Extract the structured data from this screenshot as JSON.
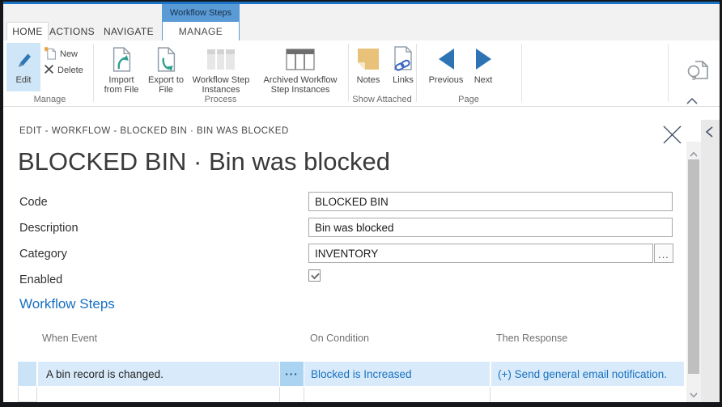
{
  "colors": {
    "accent_blue": "#1a73c7",
    "link_blue": "#1770c0",
    "contextual_tab_blue": "#5a9bd5",
    "selected_row_blue": "#d9ebfa",
    "edit_button_blue": "#cfe6f8",
    "notes_yellow": "#e9c27a"
  },
  "ribbon": {
    "contextual_label": "Workflow Steps",
    "tabs": [
      {
        "label": "HOME",
        "active": true
      },
      {
        "label": "ACTIONS"
      },
      {
        "label": "NAVIGATE"
      },
      {
        "label": "MANAGE",
        "contextual": true
      }
    ],
    "buttons": {
      "edit": "Edit",
      "new": "New",
      "delete": "Delete",
      "import": "Import from File",
      "export": "Export to File",
      "workflow_step_instances": "Workflow Step Instances",
      "archived_workflow_step_instances": "Archived Workflow Step Instances",
      "notes": "Notes",
      "links": "Links",
      "previous": "Previous",
      "next": "Next"
    },
    "groups": [
      {
        "label": "Manage"
      },
      {
        "label": "Process"
      },
      {
        "label": "Show Attached"
      },
      {
        "label": "Page"
      }
    ]
  },
  "page": {
    "caption": "EDIT - WORKFLOW - BLOCKED BIN · BIN WAS BLOCKED",
    "title": "BLOCKED BIN · Bin was blocked",
    "fields": {
      "code": {
        "label": "Code",
        "value": "BLOCKED BIN"
      },
      "description": {
        "label": "Description",
        "value": "Bin was blocked"
      },
      "category": {
        "label": "Category",
        "value": "INVENTORY",
        "lookup_glyph": "..."
      },
      "enabled": {
        "label": "Enabled",
        "checked": true
      }
    },
    "section": {
      "heading": "Workflow Steps",
      "columns": {
        "when": "When Event",
        "condition": "On Condition",
        "response": "Then Response"
      },
      "rows": [
        {
          "when_event": "A bin record is changed.",
          "assist_glyph": "···",
          "on_condition": "Blocked is Increased",
          "then_response": "(+) Send general email notification.",
          "selected": true
        }
      ]
    }
  }
}
